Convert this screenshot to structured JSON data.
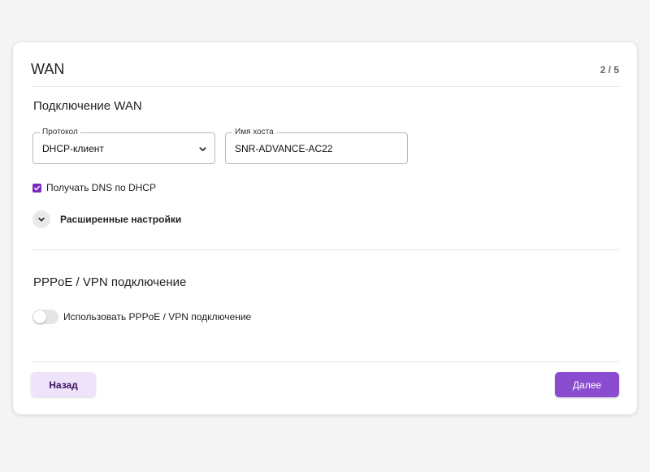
{
  "header": {
    "title": "WAN",
    "step": "2 / 5"
  },
  "wan_section": {
    "title": "Подключение WAN",
    "protocol": {
      "label": "Протокол",
      "value": "DHCP-клиент",
      "icon": "chevron-down-icon"
    },
    "hostname": {
      "label": "Имя хоста",
      "value": "SNR-ADVANCE-AC22"
    },
    "dns_checkbox": {
      "label": "Получать DNS по DHCP",
      "checked": true
    },
    "advanced": {
      "label": "Расширенные настройки",
      "icon": "chevron-down-icon"
    }
  },
  "vpn_section": {
    "title": "PPPoE / VPN подключение",
    "toggle": {
      "label": "Использовать PPPoE / VPN подключение",
      "on": false
    }
  },
  "footer": {
    "back_label": "Назад",
    "next_label": "Далее"
  },
  "colors": {
    "accent": "#8a4dd0",
    "checkbox": "#7b2cbf",
    "back_button_bg": "#efe3fa"
  }
}
